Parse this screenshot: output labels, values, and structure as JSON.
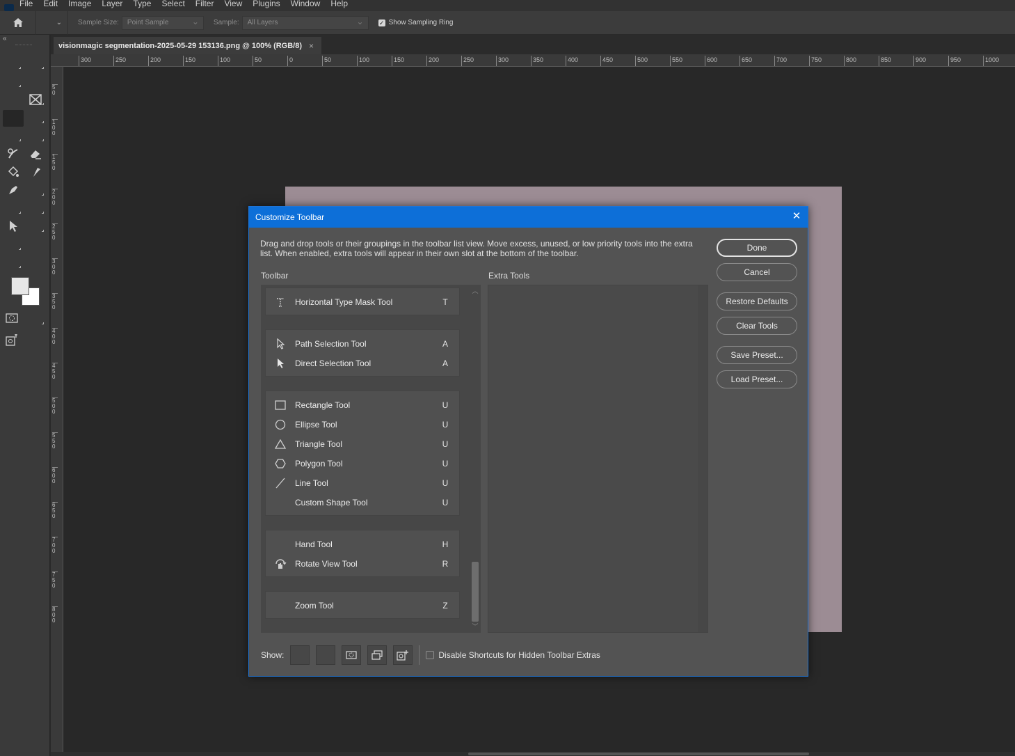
{
  "menu": {
    "items": [
      "File",
      "Edit",
      "Image",
      "Layer",
      "Type",
      "Select",
      "Filter",
      "View",
      "Plugins",
      "Window",
      "Help"
    ]
  },
  "options": {
    "sample_size_label": "Sample Size:",
    "sample_size_value": "Point Sample",
    "sample_label": "Sample:",
    "sample_value": "All Layers",
    "show_ring_label": "Show Sampling Ring",
    "show_ring_checked": true
  },
  "document": {
    "tab_title": "visionmagic segmentation-2025-05-29 153136.png @ 100% (RGB/8)",
    "tab_close": "×",
    "image_color": "#9c8c94"
  },
  "ruler": {
    "h_labels": [
      "300",
      "250",
      "200",
      "150",
      "100",
      "50",
      "0",
      "50",
      "100",
      "150",
      "200",
      "250",
      "300",
      "350",
      "400",
      "450",
      "500",
      "550",
      "600",
      "650",
      "700",
      "750",
      "800",
      "850",
      "900",
      "950",
      "1000"
    ],
    "v_labels": [
      "50",
      "100",
      "150",
      "200",
      "250",
      "300",
      "350",
      "400",
      "450",
      "500",
      "550",
      "600",
      "650",
      "700",
      "750",
      "800"
    ]
  },
  "dialog": {
    "title": "Customize Toolbar",
    "close": "✕",
    "description": "Drag and drop tools or their groupings in the toolbar list view. Move excess, unused, or low priority tools into the extra list. When enabled, extra tools will appear in their own slot at the bottom of the toolbar.",
    "toolbar_label": "Toolbar",
    "extra_label": "Extra Tools",
    "groups": [
      {
        "tools": [
          {
            "name": "Horizontal Type Mask Tool",
            "key": "T",
            "icon": "type-mask-icon"
          }
        ]
      },
      {
        "tools": [
          {
            "name": "Path Selection Tool",
            "key": "A",
            "icon": "path-selection-icon"
          },
          {
            "name": "Direct Selection Tool",
            "key": "A",
            "icon": "direct-selection-icon"
          }
        ]
      },
      {
        "tools": [
          {
            "name": "Rectangle Tool",
            "key": "U",
            "icon": "rectangle-icon"
          },
          {
            "name": "Ellipse Tool",
            "key": "U",
            "icon": "ellipse-icon"
          },
          {
            "name": "Triangle Tool",
            "key": "U",
            "icon": "triangle-icon"
          },
          {
            "name": "Polygon Tool",
            "key": "U",
            "icon": "polygon-icon"
          },
          {
            "name": "Line Tool",
            "key": "U",
            "icon": "line-icon"
          },
          {
            "name": "Custom Shape Tool",
            "key": "U",
            "icon": "none"
          }
        ]
      },
      {
        "tools": [
          {
            "name": "Hand Tool",
            "key": "H",
            "icon": "none"
          },
          {
            "name": "Rotate View Tool",
            "key": "R",
            "icon": "rotate-view-icon"
          }
        ]
      },
      {
        "tools": [
          {
            "name": "Zoom Tool",
            "key": "Z",
            "icon": "none"
          }
        ]
      }
    ],
    "buttons": {
      "done": "Done",
      "cancel": "Cancel",
      "restore": "Restore Defaults",
      "clear": "Clear Tools",
      "save": "Save Preset...",
      "load": "Load Preset..."
    },
    "show_label": "Show:",
    "disable_shortcuts_label": "Disable Shortcuts for Hidden Toolbar Extras",
    "disable_shortcuts_checked": false
  },
  "colors": {
    "accent": "#0d6fd8",
    "dialog_bg": "#535353",
    "app_bg": "#282828"
  }
}
